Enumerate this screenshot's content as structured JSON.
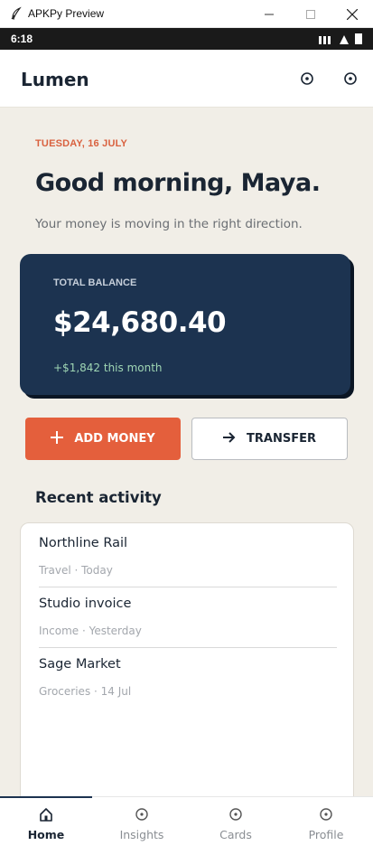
{
  "window": {
    "title": "APKPy Preview"
  },
  "status_bar": {
    "time": "6:18"
  },
  "header": {
    "brand": "Lumen"
  },
  "main": {
    "date": "TUESDAY, 16 JULY",
    "greeting": "Good morning, Maya.",
    "subtitle": "Your money is moving in the right direction.",
    "balance": {
      "label": "TOTAL BALANCE",
      "amount": "$24,680.40",
      "change": "+$1,842 this month"
    },
    "actions": {
      "add_money": "ADD MONEY",
      "transfer": "TRANSFER"
    },
    "recent_activity": {
      "title": "Recent activity",
      "items": [
        {
          "name": "Northline Rail",
          "meta": "Travel · Today"
        },
        {
          "name": "Studio invoice",
          "meta": "Income · Yesterday"
        },
        {
          "name": "Sage Market",
          "meta": "Groceries · 14 Jul"
        }
      ]
    }
  },
  "bottom_nav": {
    "items": [
      {
        "label": "Home",
        "icon": "home-icon",
        "active": true
      },
      {
        "label": "Insights",
        "icon": "insights-icon",
        "active": false
      },
      {
        "label": "Cards",
        "icon": "cards-icon",
        "active": false
      },
      {
        "label": "Profile",
        "icon": "profile-icon",
        "active": false
      }
    ]
  },
  "colors": {
    "accent": "#e45f3c",
    "navy": "#1c3350",
    "background": "#f1eee7",
    "positive": "#9fd6b4"
  }
}
